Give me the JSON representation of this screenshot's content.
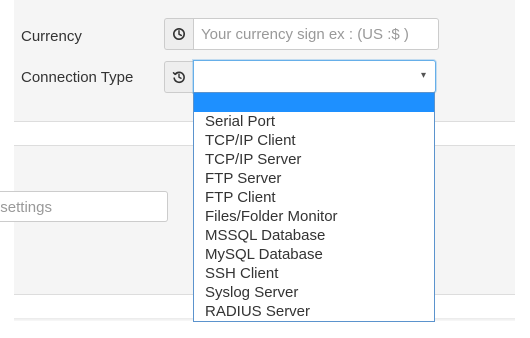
{
  "form": {
    "currency": {
      "label": "Currency",
      "placeholder": "Your currency sign ex : (US :$ )",
      "value": "",
      "icon": "clock-icon"
    },
    "connection_type": {
      "label": "Connection Type",
      "selected_value": "",
      "icon": "history-icon",
      "arrow": "▾",
      "options": [
        "",
        "Serial Port",
        "TCP/IP Client",
        "TCP/IP Server",
        "FTP Server",
        "FTP Client",
        "Files/Folder Monitor",
        "MSSQL Database",
        "MySQL Database",
        "SSH Client",
        "Syslog Server",
        "RADIUS Server"
      ]
    },
    "settings": {
      "visible_text": "ur settings"
    }
  },
  "colors": {
    "panel_background": "#f5f5f5",
    "input_border": "#cccccc",
    "focus_border": "#66afe9",
    "dropdown_highlight": "#1e90ff",
    "text": "#333333",
    "placeholder": "#999999"
  }
}
